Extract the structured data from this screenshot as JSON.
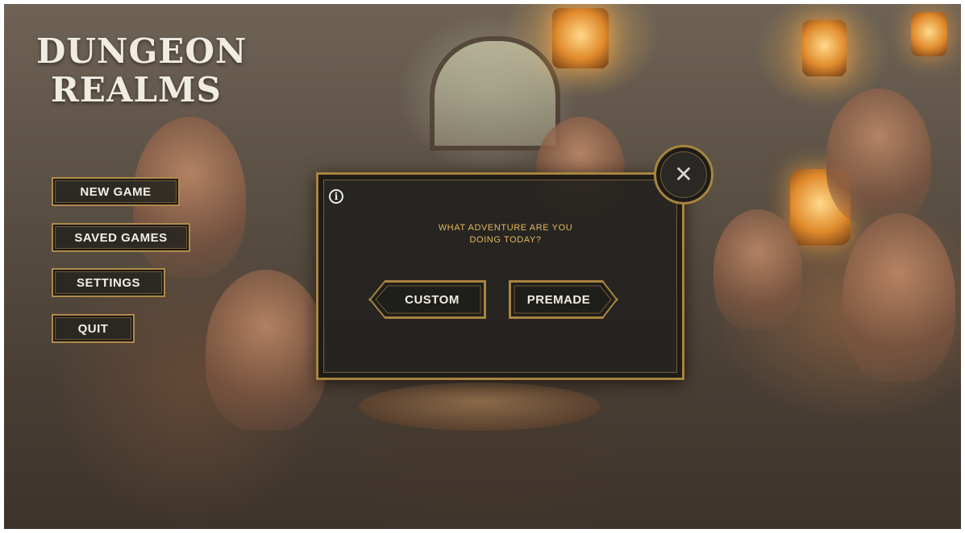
{
  "game": {
    "title_line1": "DUNGEON",
    "title_line2": "REALMS"
  },
  "main_menu": {
    "items": [
      {
        "label": "NEW GAME"
      },
      {
        "label": "SAVED GAMES"
      },
      {
        "label": "SETTINGS"
      },
      {
        "label": "QUIT"
      }
    ]
  },
  "dialog": {
    "prompt_line1": "WHAT ADVENTURE ARE YOU",
    "prompt_line2": "DOING TODAY?",
    "custom_label": "CUSTOM",
    "premade_label": "PREMADE",
    "info_icon_glyph": "i",
    "close_icon_glyph": "✕"
  },
  "colors": {
    "accent_gold": "#a8843f",
    "prompt_text": "#e3b75a",
    "panel_dark": "#22211f"
  }
}
